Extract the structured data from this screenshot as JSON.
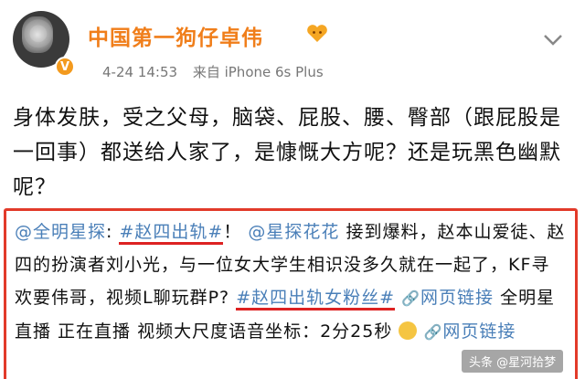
{
  "post": {
    "username": "中国第一狗仔卓伟",
    "date": "4-24 14:53",
    "source": "来自 iPhone 6s Plus",
    "body": "身体发肤，受之父母，脑袋、屁股、腰、臀部（跟屁股是一回事）都送给人家了，是慷慨大方呢？还是玩黑色幽默呢？"
  },
  "quote": {
    "mention1": "@全明星探",
    "sep1": ":",
    "tag1": "#赵四出轨#",
    "exclaim": "！",
    "mention2": "@星探花花",
    "text1": "接到爆料，赵本山爱徒、赵四的扮演者刘小光，与一位女大学生相识没多久就在一起了，KF寻欢要伟哥，视频L聊玩群P?",
    "tag2": "#赵四出轨女粉丝#",
    "link1": "网页链接",
    "text2": "全明星直播 正在直播 视频大尺度语音坐标：2分25秒",
    "link2": "网页链接"
  },
  "watermark": "头条 @星河拾梦",
  "icons": {
    "verified": "verified-badge-icon",
    "chevron": "chevron-down-icon",
    "link": "link-icon",
    "clock": "clock-emoji-icon"
  },
  "colors": {
    "username": "#f07e1a",
    "link": "#4a7fb8",
    "highlight_box": "#e23a2a"
  }
}
